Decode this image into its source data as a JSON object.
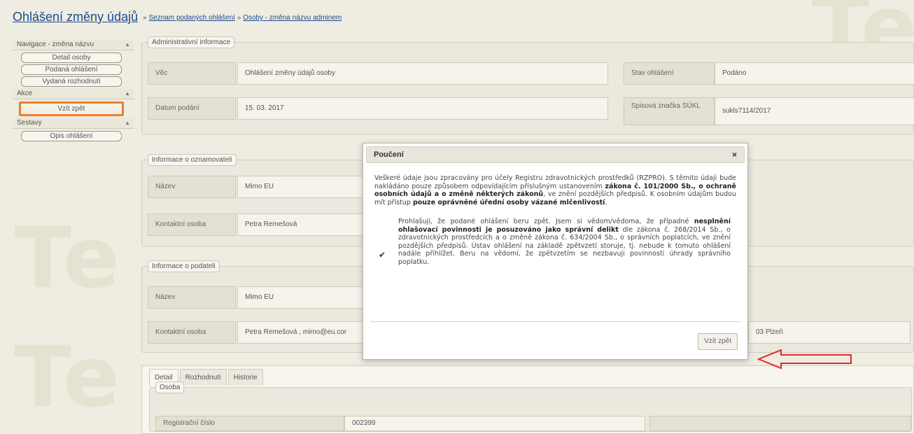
{
  "header": {
    "title": "Ohlášení změny údajů",
    "separator": "»",
    "crumbs": [
      "Seznam podaných ohlášení",
      "Osoby - změna názvu adminem"
    ]
  },
  "sidebar": {
    "nav_title": "Navigace - změna názvu",
    "nav_items": [
      "Detail osoby",
      "Podaná ohlášení",
      "Vydaná rozhodnutí"
    ],
    "actions_title": "Akce",
    "action_button": "Vzít zpět",
    "reports_title": "Sestavy",
    "report_button": "Opis ohlášení"
  },
  "admin": {
    "legend": "Administrativní informace",
    "form_label": "Věc",
    "form_value": "Ohlášení změny údajů osoby",
    "state_label": "Stav ohlášení",
    "state_value": "Podáno",
    "date_label": "Datum podání",
    "date_value": "15. 03. 2017",
    "file_label": "Spisová značka SÚKL",
    "file_value": "sukls7114/2017"
  },
  "notifier": {
    "legend": "Informace o oznamovateli",
    "name_label": "Název",
    "name_value": "Mimo EU",
    "contact_label": "Kontaktní osoba",
    "contact_value": "Petra Remešová"
  },
  "submitter": {
    "legend": "Informace o podateli",
    "name_label": "Název",
    "name_value": "Mimo EU",
    "contact_label": "Kontaktní osoba",
    "contact_value": "Petra Remešová , mimo@eu.cor",
    "address_tail": "03 Plzeň"
  },
  "tabs": {
    "items": [
      "Detail",
      "Rozhodnutí",
      "Historie"
    ],
    "section_legend": "Osoba",
    "reg_label": "Registrační číslo",
    "reg_value": "002399"
  },
  "modal": {
    "title": "Poučení",
    "close": "×",
    "para1_a": "Veškeré údaje jsou zpracovány pro účely Registru zdravotnických prostředků (RZPRO). S těmito údaji bude nakládáno pouze způsobem odpovídajícím příslušným ustanovením ",
    "para1_b": "zákona č. 101/2000 Sb., o ochraně osobních údajů a o změně některých zákonů",
    "para1_c": ", ve znění pozdějších předpisů. K osobním údajům budou mít přístup ",
    "para1_d": "pouze oprávněné úřední osoby vázané mlčenlivostí",
    "para1_e": ".",
    "checkbox_mark": "✔",
    "para2_a": "Prohlašuji, že podané ohlášení beru zpět. Jsem si vědom/vědoma, že případné ",
    "para2_b": "nesplnění ohlašovací povinnosti je posuzováno jako správní delikt",
    "para2_c": " dle zákona č. 268/2014 Sb., o zdravotnických prostředcích a o změně zákona č. 634/2004 Sb., o správních poplatcích, ve znění pozdějších předpisů. Ústav ohlášení na základě zpětvzetí storuje, tj. nebude k tomuto ohlášení nadále přihlížet. Beru na vědomí, že zpětvzetím se nezbavuji povinnosti úhrady správního poplatku.",
    "button": "Vzít zpět"
  },
  "colors": {
    "accent": "#f07d2a",
    "link": "#1b4c8c",
    "arrow": "#e32b2b"
  }
}
